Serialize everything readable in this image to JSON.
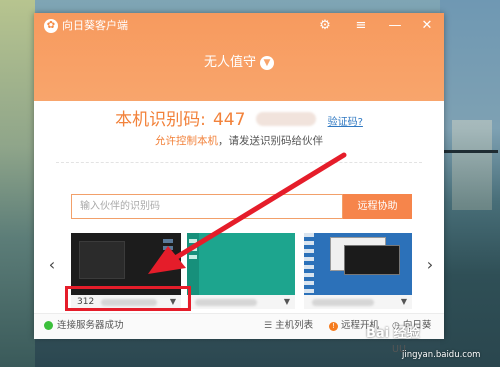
{
  "window": {
    "app_title": "向日葵客户端",
    "logo_glyph": "✿",
    "mode_label": "无人值守"
  },
  "titlebar_icons": [
    "gear-icon",
    "menu-icon",
    "minimize-icon",
    "close-icon"
  ],
  "identity": {
    "id_label": "本机识别码:",
    "id_prefix": "447",
    "verify_link": "验证码?",
    "hint_link": "允许控制本机",
    "hint_text": "，请发送识别码给伙伴"
  },
  "connect": {
    "input_placeholder": "输入伙伴的识别码",
    "input_value": "",
    "button_label": "远程协助"
  },
  "devices": [
    {
      "label": "312",
      "caret": "▼"
    },
    {
      "label": "",
      "caret": "▼"
    },
    {
      "label": "",
      "caret": "▼"
    }
  ],
  "status": {
    "connection_text": "连接服务器成功",
    "host_list": "主机列表",
    "remote_boot": "远程开机",
    "sunflower": "向日葵UU"
  },
  "watermark": {
    "brand": "Bai 经验",
    "url": "jingyan.baidu.com"
  },
  "colors": {
    "accent": "#f6854b",
    "highlight": "#e51d2a",
    "status_ok": "#3bbf3b"
  }
}
